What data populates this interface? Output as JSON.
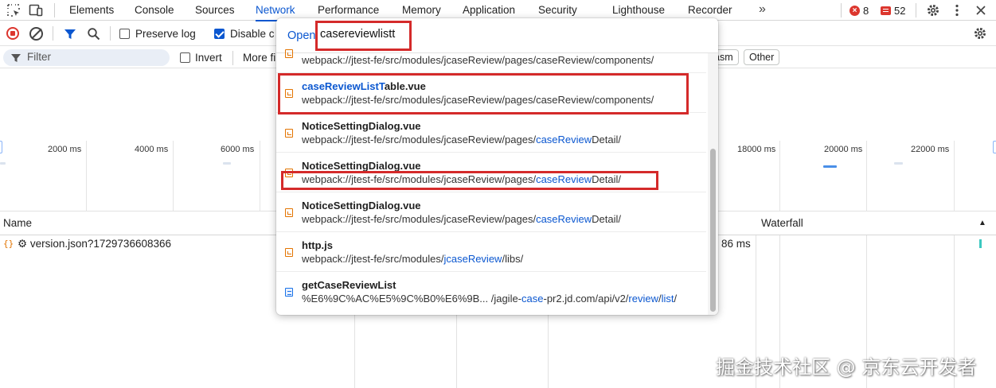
{
  "tabs": [
    "Elements",
    "Console",
    "Sources",
    "Network",
    "Performance",
    "Memory",
    "Application",
    "Security",
    "Lighthouse",
    "Recorder"
  ],
  "active_tab": "Network",
  "more_tabs_label": "»",
  "counts": {
    "errors": "8",
    "issues": "52"
  },
  "toolbar": {
    "preserve_log": "Preserve log",
    "disable_cache": "Disable c"
  },
  "filter": {
    "placeholder": "Filter",
    "invert": "Invert",
    "more_filters": "More fi",
    "chip_wasm": "asm",
    "chip_other": "Other"
  },
  "overview_ticks": [
    {
      "label": "2000 ms"
    },
    {
      "label": "4000 ms"
    },
    {
      "label": "6000 ms"
    },
    {
      "label": "18000 ms"
    },
    {
      "label": "20000 ms"
    },
    {
      "label": "22000 ms"
    }
  ],
  "table": {
    "col_name": "Name",
    "col_waterfall": "Waterfall",
    "sort_indicator": "▲",
    "rows": [
      {
        "name": "⚙ version.json?1729736608366",
        "time": "86 ms"
      }
    ]
  },
  "quick_open": {
    "prefix": "Open",
    "query": "casereviewlistt",
    "items": [
      {
        "title": "",
        "path_parts": [
          "webpack://jtest-fe/src/modules/jcaseReview/pages/caseReview/components/"
        ],
        "icon": "script-icon"
      },
      {
        "title_hl": "caseReviewListT",
        "title_rest": "able.vue",
        "path_parts": [
          "webpack://jtest-fe/src/modules/jcaseReview/pages/caseReview/components/"
        ],
        "icon": "script-icon"
      },
      {
        "title": "NoticeSettingDialog.vue",
        "path_pre": "webpack://jtest-fe/src/modules/jcaseReview/pages/",
        "path_hl": "caseReview",
        "path_post": "Detail/",
        "icon": "script-icon"
      },
      {
        "title": "NoticeSettingDialog.vue",
        "path_pre": "webpack://jtest-fe/src/modules/jcaseReview/pages/",
        "path_hl": "caseReview",
        "path_post": "Detail/",
        "icon": "script-icon"
      },
      {
        "title": "NoticeSettingDialog.vue",
        "path_pre": "webpack://jtest-fe/src/modules/jcaseReview/pages/",
        "path_hl": "caseReview",
        "path_post": "Detail/",
        "icon": "script-icon"
      },
      {
        "title": "http.js",
        "path_pre": "webpack://jtest-fe/src/modules/",
        "path_hl": "jcaseReview",
        "path_post": "/libs/",
        "icon": "script-icon"
      },
      {
        "title": "getCaseReviewList",
        "path_pre": "%E6%9C%AC%E5%9C%B0%E6%9B... /jagile-",
        "path_hl": "case",
        "path_mid": "-pr2.jd.com/api/v2/",
        "path_hl2": "review",
        "path_mid2": "/",
        "path_hl3": "list",
        "path_post": "/",
        "icon": "document-icon"
      }
    ]
  },
  "watermark": "掘金技术社区 @ 京东云开发者",
  "colors": {
    "accent": "#0b57d0",
    "annotation": "#d42a2a",
    "record": "#dc362e"
  }
}
